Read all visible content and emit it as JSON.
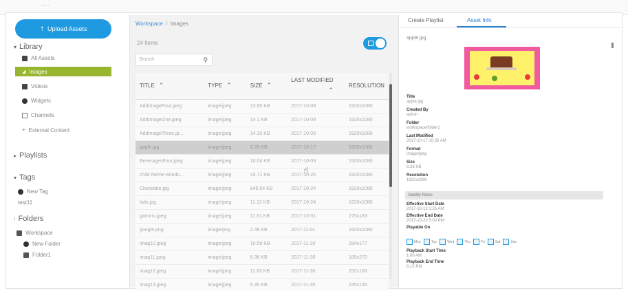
{
  "topbar": {
    "text": "......"
  },
  "sidebar": {
    "upload_label": "Upload Assets",
    "library_label": "Library",
    "items": [
      {
        "label": "All Assets",
        "icon": "image-stack-icon"
      },
      {
        "label": "Images",
        "icon": "image-icon",
        "active": true
      },
      {
        "label": "Videos",
        "icon": "video-camera-icon"
      },
      {
        "label": "Widgets",
        "icon": "widget-icon"
      },
      {
        "label": "Channels",
        "icon": "channel-icon"
      },
      {
        "label": "External Content",
        "icon": "external-content-icon"
      }
    ],
    "playlists_label": "Playlists",
    "tags_label": "Tags",
    "new_tag_label": "New Tag",
    "tag_item": "test11",
    "folders_label": "Folders",
    "workspace_label": "Workspace",
    "new_folder_label": "New Folder",
    "folder1_label": "Folder1",
    "accent_color": "#1e9ae0",
    "active_color": "#98b530"
  },
  "center": {
    "breadcrumb_root": "Workspace",
    "breadcrumb_sep": "/",
    "breadcrumb_current": "Images",
    "item_count": "24 Items",
    "search_placeholder": "Search",
    "columns": [
      "TITLE",
      "TYPE",
      "SIZE",
      "LAST MODIFIED",
      "RESOLUTION"
    ],
    "rows": [
      [
        "AddImageFour.jpeg",
        "image/jpeg",
        "13.95 KB",
        "2017-10-09",
        "1920x1080"
      ],
      [
        "AddImageOne.jpeg",
        "image/jpeg",
        "14.1 KB",
        "2017-10-09",
        "1920x1080"
      ],
      [
        "AddImageThree.jp...",
        "image/jpeg",
        "14.33 KB",
        "2017-10-09",
        "1920x1080"
      ],
      [
        "apple.jpg",
        "image/jpeg",
        "8.28 KB",
        "2017-10-17",
        "1920x1080"
      ],
      [
        "BeveragesFour.jpeg",
        "image/jpeg",
        "10.04 KB",
        "2017-10-09",
        "1920x1080"
      ],
      [
        "child theme wiredo...",
        "image/jpeg",
        "43.71 KB",
        "2017-10-26",
        "1920x1080"
      ],
      [
        "Chocolate.jpg",
        "image/jpeg",
        "845.54 KB",
        "2017-10-24",
        "1920x1080"
      ],
      [
        "fails.jpg",
        "image/jpeg",
        "11.12 KB",
        "2017-10-24",
        "1920x1080"
      ],
      [
        "gammu.jpeg",
        "image/jpeg",
        "11.61 KB",
        "2017-10-31",
        "275x183"
      ],
      [
        "google.png",
        "image/png",
        "2.48 KB",
        "2017-11-01",
        "1920x1080"
      ],
      [
        "imag10.jpeg",
        "image/jpeg",
        "10.59 KB",
        "2017-11-30",
        "284x177"
      ],
      [
        "imag11.jpeg",
        "image/jpeg",
        "8.38 KB",
        "2017-11-30",
        "185x272"
      ],
      [
        "imag12.jpeg",
        "image/jpeg",
        "11.83 KB",
        "2017-11-30",
        "292x168"
      ],
      [
        "imag13.jpeg",
        "image/jpeg",
        "6.35 KB",
        "2017-11-30",
        "245x135"
      ]
    ],
    "selected_row": 3
  },
  "right": {
    "tabs": [
      "Create Playlist",
      "Asset Info"
    ],
    "active_tab": 1,
    "filename": "apple.jpg",
    "meta": [
      {
        "k": "Title",
        "v": "apple.jpg"
      },
      {
        "k": "Created By",
        "v": "admin"
      },
      {
        "k": "Folder",
        "v": "workspace/folder1"
      },
      {
        "k": "Last Modified",
        "v": "2017-10-17 10:35 AM"
      },
      {
        "k": "Format",
        "v": "image/jpeg"
      },
      {
        "k": "Size",
        "v": "8.28 KB"
      },
      {
        "k": "Resolution",
        "v": "1920x1080"
      }
    ],
    "validity_label": "Validity Rules",
    "validity": [
      {
        "k": "Effective Start Date",
        "v": "2017-10-13 1:25 AM"
      },
      {
        "k": "Effective End Date",
        "v": "2017-10-20 5:00 PM"
      },
      {
        "k": "Playable On",
        "v": ""
      }
    ],
    "days": [
      "Mon",
      "Tue",
      "Wed",
      "Thu",
      "Fri",
      "Sat",
      "Sun"
    ],
    "playback": [
      {
        "k": "Playback Start Time",
        "v": "1:00 AM"
      },
      {
        "k": "Playback End Time",
        "v": "6:15 PM"
      }
    ]
  }
}
